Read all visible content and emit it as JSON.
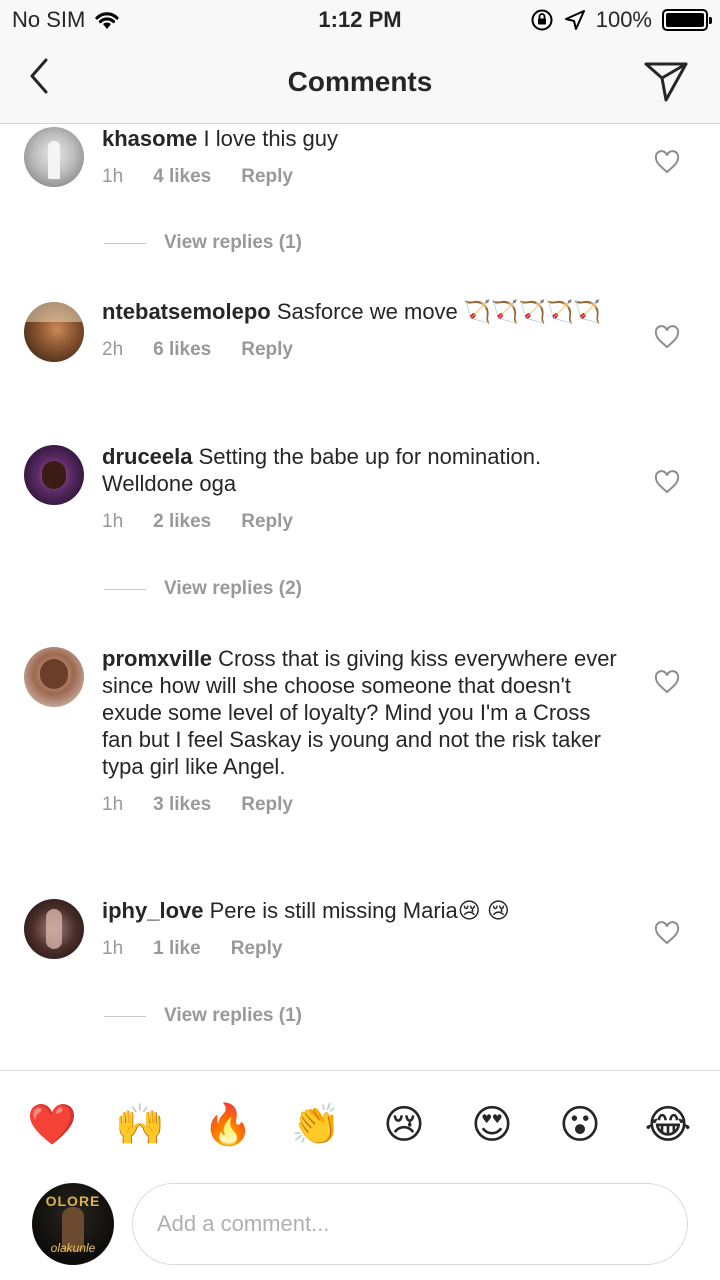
{
  "status_bar": {
    "carrier": "No SIM",
    "time": "1:12 PM",
    "battery": "100%",
    "battery_level": 1.0
  },
  "nav": {
    "title": "Comments",
    "back_icon": "chevron-left-icon",
    "send_icon": "direct-send-icon"
  },
  "comments": [
    {
      "username": "khasome",
      "text": "I love this guy",
      "time": "1h",
      "likes": "4 likes",
      "reply": "Reply",
      "view_replies": "View replies (1)"
    },
    {
      "username": "ntebatsemolepo",
      "text": "Sasforce we move 🏹🏹🏹🏹🏹",
      "time": "2h",
      "likes": "6 likes",
      "reply": "Reply"
    },
    {
      "username": "druceela",
      "text": "Setting the babe up for nomination. Welldone oga",
      "time": "1h",
      "likes": "2 likes",
      "reply": "Reply",
      "view_replies": "View replies (2)"
    },
    {
      "username": "promxville",
      "text": "Cross that is giving kiss everywhere ever since how will she choose someone that doesn't exude some level of loyalty? Mind you I'm a Cross fan but I feel Saskay is young and not the risk taker typa girl like Angel.",
      "time": "1h",
      "likes": "3 likes",
      "reply": "Reply"
    },
    {
      "username": "iphy_love",
      "text": "Pere is still missing Maria😢 😢",
      "time": "1h",
      "likes": "1 like",
      "reply": "Reply",
      "view_replies": "View replies (1)"
    }
  ],
  "emoji_bar": [
    "❤️",
    "🙌",
    "🔥",
    "👏",
    "😢",
    "😍",
    "😮",
    "😂"
  ],
  "composer": {
    "placeholder": "Add a comment...",
    "avatar_text": "OLORE",
    "avatar_signature": "olakunle"
  },
  "colors": {
    "text": "#262626",
    "meta": "#999999",
    "bar_bg": "#f8f8f8",
    "border": "#dbdbdb"
  }
}
